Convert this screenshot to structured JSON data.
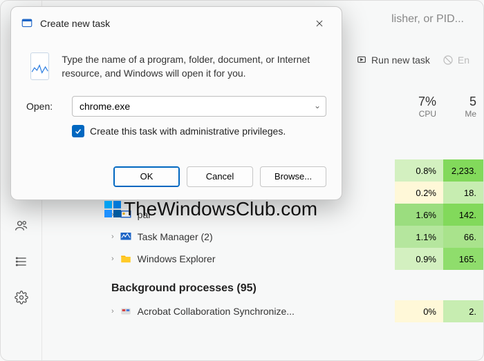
{
  "dialog": {
    "title": "Create new task",
    "intro": "Type the name of a program, folder, document, or Internet resource, and Windows will open it for you.",
    "open_label": "Open:",
    "open_value": "chrome.exe",
    "admin_label": "Create this task with administrative privileges.",
    "ok": "OK",
    "cancel": "Cancel",
    "browse": "Browse..."
  },
  "tm": {
    "search_placeholder": "lisher, or PID...",
    "run_task": "Run new task",
    "end": "En",
    "head": {
      "cpu_pct": "7%",
      "cpu_lbl": "CPU",
      "mem_pct": "5",
      "mem_lbl": "Me"
    },
    "rows": [
      {
        "name": "",
        "cpu": "0.8%",
        "mem": "2,233."
      },
      {
        "name": "",
        "cpu": "0.2%",
        "mem": "18."
      },
      {
        "name": "pai",
        "cpu": "1.6%",
        "mem": "142."
      },
      {
        "name": "Task Manager (2)",
        "cpu": "1.1%",
        "mem": "66."
      },
      {
        "name": "Windows Explorer",
        "cpu": "0.9%",
        "mem": "165."
      }
    ],
    "bg_header": "Background processes (95)",
    "bg_rows": [
      {
        "name": "Acrobat Collaboration Synchronize...",
        "cpu": "0%",
        "mem": "2."
      }
    ]
  },
  "watermark": "TheWindowsClub.com"
}
